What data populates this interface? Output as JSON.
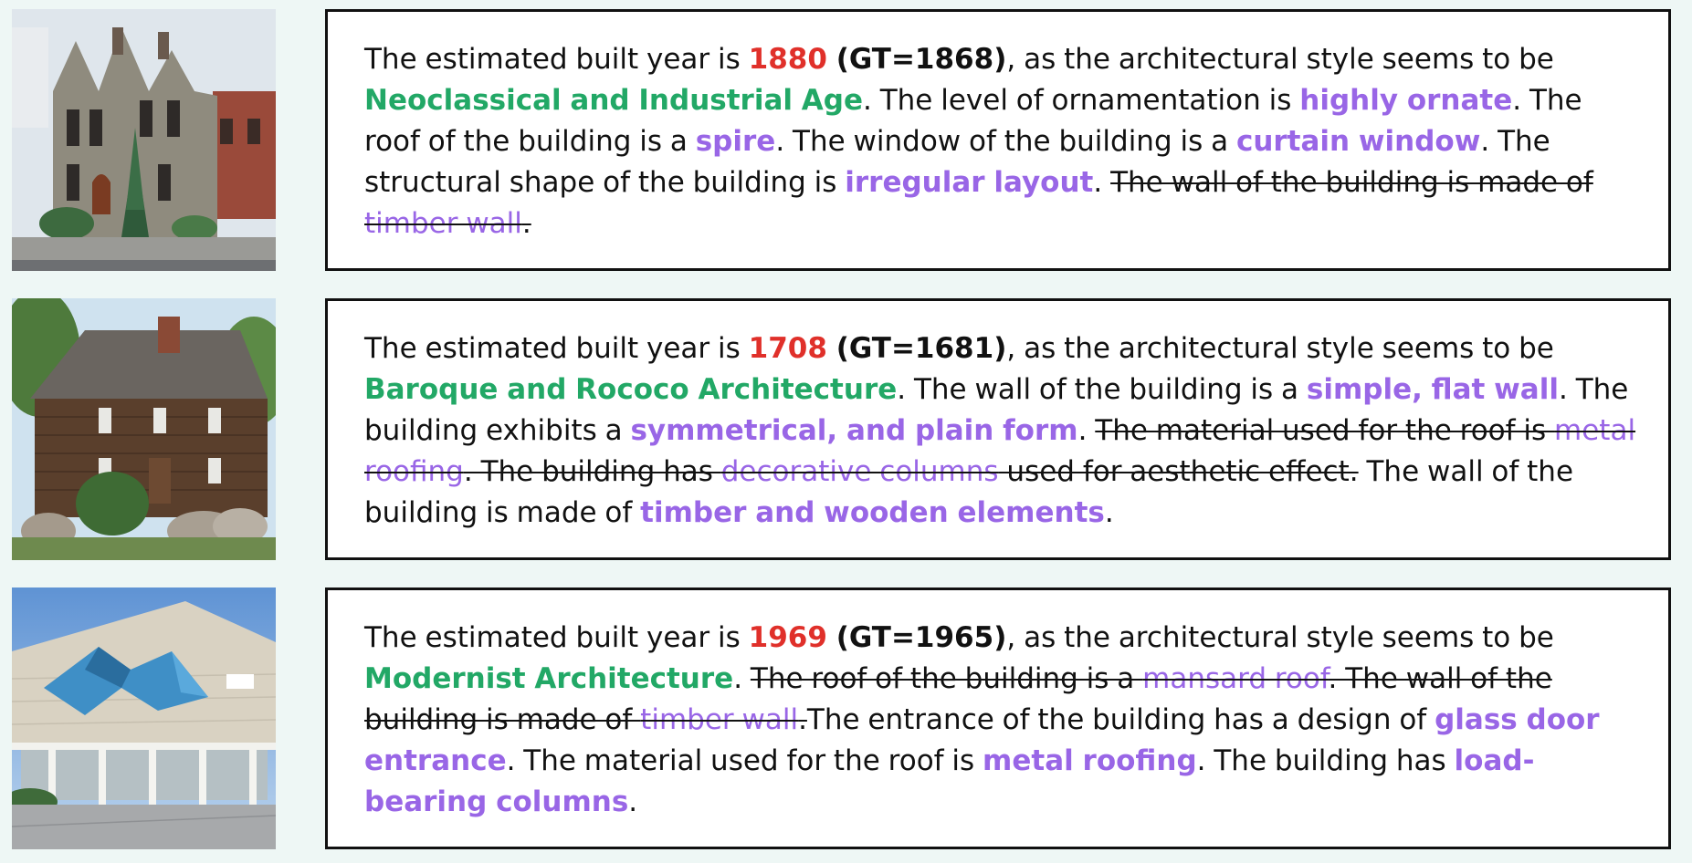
{
  "colors": {
    "background": "#eef7f5",
    "year": "#e0302a",
    "style": "#22a866",
    "attribute": "#9966e6",
    "text": "#111111"
  },
  "rows": [
    {
      "segments": [
        {
          "text": "The estimated built year is ",
          "kind": "plain"
        },
        {
          "text": "1880",
          "kind": "year"
        },
        {
          "text": " (GT=1868)",
          "kind": "gt"
        },
        {
          "text": ", as the architectural style seems to be ",
          "kind": "plain"
        },
        {
          "text": "Neoclassical and Industrial Age",
          "kind": "style"
        },
        {
          "text": ". The level of ornamentation is ",
          "kind": "plain"
        },
        {
          "text": "highly ornate",
          "kind": "attr"
        },
        {
          "text": ". The roof of the building is a ",
          "kind": "plain"
        },
        {
          "text": "spire",
          "kind": "attr"
        },
        {
          "text": ". The window of the building is a ",
          "kind": "plain"
        },
        {
          "text": "curtain window",
          "kind": "attr"
        },
        {
          "text": ". The structural shape of the building is ",
          "kind": "plain"
        },
        {
          "text": "irregular layout",
          "kind": "attr"
        },
        {
          "text": ". ",
          "kind": "plain"
        },
        {
          "text": "The wall of the building is made of ",
          "kind": "strike"
        },
        {
          "text": "timber wall",
          "kind": "strike-attr"
        },
        {
          "text": ".",
          "kind": "strike"
        }
      ]
    },
    {
      "segments": [
        {
          "text": "The estimated built year is ",
          "kind": "plain"
        },
        {
          "text": "1708",
          "kind": "year"
        },
        {
          "text": " (GT=1681)",
          "kind": "gt"
        },
        {
          "text": ", as the architectural style seems to be ",
          "kind": "plain"
        },
        {
          "text": "Baroque and Rococo Architecture",
          "kind": "style"
        },
        {
          "text": ". The wall of the building is a ",
          "kind": "plain"
        },
        {
          "text": "simple, flat wall",
          "kind": "attr"
        },
        {
          "text": ". The building exhibits a ",
          "kind": "plain"
        },
        {
          "text": "symmetrical, and plain form",
          "kind": "attr"
        },
        {
          "text": ". ",
          "kind": "plain"
        },
        {
          "text": "The material used for the roof is ",
          "kind": "strike"
        },
        {
          "text": "metal roofing",
          "kind": "strike-attr"
        },
        {
          "text": ". The building has ",
          "kind": "strike"
        },
        {
          "text": "decorative columns",
          "kind": "strike-attr"
        },
        {
          "text": " used for aesthetic effect.",
          "kind": "strike"
        },
        {
          "text": " The wall of the building is made of ",
          "kind": "plain"
        },
        {
          "text": "timber and wooden elements",
          "kind": "attr"
        },
        {
          "text": ".",
          "kind": "plain"
        }
      ]
    },
    {
      "segments": [
        {
          "text": "The estimated built year is ",
          "kind": "plain"
        },
        {
          "text": "1969",
          "kind": "year"
        },
        {
          "text": " (GT=1965)",
          "kind": "gt"
        },
        {
          "text": ", as the architectural style seems to be ",
          "kind": "plain"
        },
        {
          "text": "Modernist Architecture",
          "kind": "style"
        },
        {
          "text": ". ",
          "kind": "plain"
        },
        {
          "text": "The roof of the building is a ",
          "kind": "strike"
        },
        {
          "text": "mansard roof",
          "kind": "strike-attr"
        },
        {
          "text": ". The wall of the building is made of ",
          "kind": "strike"
        },
        {
          "text": "timber wall",
          "kind": "strike-attr"
        },
        {
          "text": ".",
          "kind": "strike"
        },
        {
          "text": "The entrance of the building has a design of ",
          "kind": "plain"
        },
        {
          "text": "glass door entrance",
          "kind": "attr"
        },
        {
          "text": ". The material used for the roof is ",
          "kind": "plain"
        },
        {
          "text": "metal roofing",
          "kind": "attr"
        },
        {
          "text": ". The building has ",
          "kind": "plain"
        },
        {
          "text": "load-bearing columns",
          "kind": "attr"
        },
        {
          "text": ".",
          "kind": "plain"
        }
      ]
    }
  ]
}
